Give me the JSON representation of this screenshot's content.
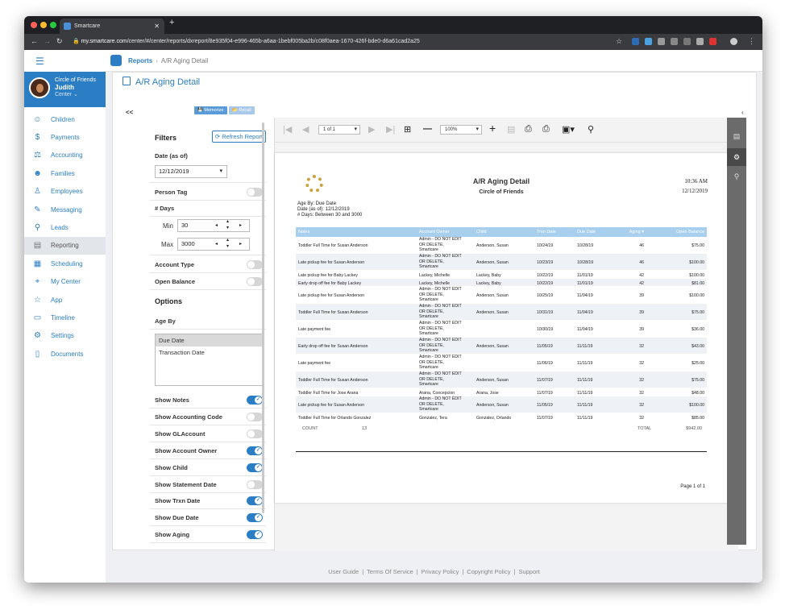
{
  "browser": {
    "tab_title": "Smartcare",
    "url_host": "my.smartcare.com",
    "url_path": "/center/#/center/reports/dxreport/8e935f04-e996-465b-a6aa-1bebf005ba2b/c08f0aea-1670-426f-bde0-d6a61cad2a25"
  },
  "profile": {
    "org": "Circle of Friends",
    "name": "Judith",
    "role": "Center ⌄"
  },
  "sidebar": {
    "items": [
      {
        "label": "Children",
        "icon": "children-icon",
        "glyph": "☺"
      },
      {
        "label": "Payments",
        "icon": "payments-icon",
        "glyph": "$"
      },
      {
        "label": "Accounting",
        "icon": "accounting-icon",
        "glyph": "⚖"
      },
      {
        "label": "Families",
        "icon": "families-icon",
        "glyph": "☻"
      },
      {
        "label": "Employees",
        "icon": "employees-icon",
        "glyph": "♙"
      },
      {
        "label": "Messaging",
        "icon": "messaging-icon",
        "glyph": "✎"
      },
      {
        "label": "Leads",
        "icon": "leads-icon",
        "glyph": "⚲"
      },
      {
        "label": "Reporting",
        "icon": "reporting-icon",
        "glyph": "▤"
      },
      {
        "label": "Scheduling",
        "icon": "scheduling-icon",
        "glyph": "▦"
      },
      {
        "label": "My Center",
        "icon": "my-center-icon",
        "glyph": "⌖"
      },
      {
        "label": "App",
        "icon": "app-icon",
        "glyph": "☆"
      },
      {
        "label": "Timeline",
        "icon": "timeline-icon",
        "glyph": "▭"
      },
      {
        "label": "Settings",
        "icon": "settings-icon",
        "glyph": "⚙"
      },
      {
        "label": "Documents",
        "icon": "documents-icon",
        "glyph": "▯"
      }
    ],
    "active": "Reporting"
  },
  "breadcrumb": {
    "root": "Reports",
    "separator": "›",
    "current": "A/R Aging Detail"
  },
  "page_title": "A/R Aging Detail",
  "filters": {
    "collapse_label": "<<",
    "memorize_label": "💾 Memorize",
    "recall_label": "📂 Recall",
    "title": "Filters",
    "refresh_label": "⟳ Refresh Report",
    "date_label": "Date (as of)",
    "date_value": "12/12/2019",
    "person_tag_label": "Person Tag",
    "days_label": "# Days",
    "min_label": "Min",
    "min_value": "30",
    "max_label": "Max",
    "max_value": "3000",
    "account_type_label": "Account Type",
    "open_balance_label": "Open Balance"
  },
  "options": {
    "title": "Options",
    "age_by_label": "Age By",
    "age_by_options": [
      "Due Date",
      "Transaction Date"
    ],
    "age_by_selected": "Due Date",
    "toggles": [
      {
        "label": "Show Notes",
        "on": true
      },
      {
        "label": "Show Accounting Code",
        "on": false
      },
      {
        "label": "Show GLAccount",
        "on": false
      },
      {
        "label": "Show Account Owner",
        "on": true
      },
      {
        "label": "Show Child",
        "on": true
      },
      {
        "label": "Show Statement Date",
        "on": false
      },
      {
        "label": "Show Trxn Date",
        "on": true
      },
      {
        "label": "Show Due Date",
        "on": true
      },
      {
        "label": "Show Aging",
        "on": true
      }
    ]
  },
  "viewer": {
    "page_select": "1 of 1",
    "zoom": "100%"
  },
  "report": {
    "title": "A/R Aging Detail",
    "subtitle": "Circle of Friends",
    "time": "10:36 AM",
    "date": "12/12/2019",
    "meta": [
      "Age By: Due Date",
      "Date (as of): 12/12/2019",
      "# Days: Between 30 and 3000"
    ],
    "columns": [
      "Notes",
      "Account Owner",
      "Child",
      "Trxn Date",
      "Due Date",
      "Aging ▾",
      "Open Balance"
    ],
    "rows": [
      {
        "notes": "Toddler Full Time for Susan Anderson",
        "owner": "Admin - DO NOT EDIT\nOR DELETE,\nSmartcare",
        "child": "Anderson, Susan",
        "trxn": "10/24/19",
        "due": "10/28/19",
        "aging": "46",
        "bal": "$75.00"
      },
      {
        "notes": "Late pickup fee for Susan Anderson",
        "owner": "Admin - DO NOT EDIT\nOR DELETE,\nSmartcare",
        "child": "Anderson, Susan",
        "trxn": "10/23/19",
        "due": "10/28/19",
        "aging": "46",
        "bal": "$100.00"
      },
      {
        "notes": "Late pickup fee for Baby Lackey",
        "owner": "Lackey, Michelle",
        "child": "Lackey, Baby",
        "trxn": "10/22/19",
        "due": "11/01/19",
        "aging": "42",
        "bal": "$100.00"
      },
      {
        "notes": "Early drop off fee for Baby Lackey",
        "owner": "Lackey, Michelle",
        "child": "Lackey, Baby",
        "trxn": "10/22/19",
        "due": "11/01/19",
        "aging": "42",
        "bal": "$81.00"
      },
      {
        "notes": "Late pickup fee for Susan Anderson",
        "owner": "Admin - DO NOT EDIT\nOR DELETE,\nSmartcare",
        "child": "Anderson, Susan",
        "trxn": "10/25/19",
        "due": "11/04/19",
        "aging": "39",
        "bal": "$100.00"
      },
      {
        "notes": "Toddler Full Time for Susan Anderson",
        "owner": "Admin - DO NOT EDIT\nOR DELETE,\nSmartcare",
        "child": "Anderson, Susan",
        "trxn": "10/31/19",
        "due": "11/04/19",
        "aging": "39",
        "bal": "$75.00"
      },
      {
        "notes": "Late payment fee",
        "owner": "Admin - DO NOT EDIT\nOR DELETE,\nSmartcare",
        "child": "",
        "trxn": "10/30/19",
        "due": "11/04/19",
        "aging": "39",
        "bal": "$36.00"
      },
      {
        "notes": "Early drop off fee for Susan Anderson",
        "owner": "Admin - DO NOT EDIT\nOR DELETE,\nSmartcare",
        "child": "Anderson, Susan",
        "trxn": "11/05/19",
        "due": "11/11/19",
        "aging": "32",
        "bal": "$43.00"
      },
      {
        "notes": "Late payment fee",
        "owner": "Admin - DO NOT EDIT\nOR DELETE,\nSmartcare",
        "child": "",
        "trxn": "11/06/19",
        "due": "11/11/19",
        "aging": "32",
        "bal": "$25.00"
      },
      {
        "notes": "Toddler Full Time for Susan Anderson",
        "owner": "Admin - DO NOT EDIT\nOR DELETE,\nSmartcare",
        "child": "Anderson, Susan",
        "trxn": "11/07/19",
        "due": "11/11/19",
        "aging": "32",
        "bal": "$75.00"
      },
      {
        "notes": "Toddler Full Time for Jose Arana",
        "owner": "Arana, Concepcion",
        "child": "Arana, Jose",
        "trxn": "11/07/19",
        "due": "11/11/19",
        "aging": "32",
        "bal": "$48.00"
      },
      {
        "notes": "Late pickup fee for Susan Anderson",
        "owner": "Admin - DO NOT EDIT\nOR DELETE,\nSmartcare",
        "child": "Anderson, Susan",
        "trxn": "11/05/19",
        "due": "11/11/19",
        "aging": "32",
        "bal": "$100.00"
      },
      {
        "notes": "Toddler Full Time for Orlando Gonzalez",
        "owner": "Gonzalez, Tera",
        "child": "Gonzalez, Orlando",
        "trxn": "11/07/19",
        "due": "11/11/19",
        "aging": "32",
        "bal": "$85.00"
      }
    ],
    "count_label": "COUNT",
    "count_value": "13",
    "total_label": "TOTAL",
    "total_value": "$942.00",
    "page_label": "Page 1 of 1"
  },
  "footer": {
    "links": [
      "User Guide",
      "Terms Of Service",
      "Privacy Policy",
      "Copyright Policy",
      "Support"
    ],
    "separator": "|"
  },
  "colors": {
    "accent": "#2c7ec4",
    "table_header": "#a9cfee"
  }
}
